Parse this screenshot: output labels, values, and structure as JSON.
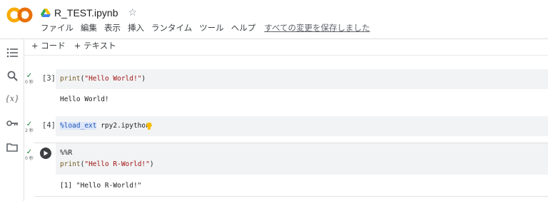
{
  "app": {
    "logo_text": "CO",
    "notebook_title": "R_TEST.ipynb",
    "star_glyph": "☆",
    "brand_colors": {
      "orange": "#f9ab00",
      "dark_orange": "#e8710a"
    }
  },
  "menu": {
    "items": [
      "ファイル",
      "編集",
      "表示",
      "挿入",
      "ランタイム",
      "ツール",
      "ヘルプ"
    ],
    "save_status": "すべての変更を保存しました"
  },
  "sidebar": {
    "icons": [
      "table-of-contents-icon",
      "search-icon",
      "variables-icon",
      "key-icon",
      "folder-icon"
    ],
    "variables_label": "{x}"
  },
  "toolbar": {
    "add_code": "+ コード",
    "add_text": "+ テキスト"
  },
  "cells": [
    {
      "check": "✓",
      "duration": "0 秒",
      "exec_count": "[3]",
      "code": {
        "fn": "print",
        "open": "(",
        "str": "\"Hello World!\"",
        "close": ")"
      },
      "output": "Hello World!"
    },
    {
      "check": "✓",
      "duration": "2 秒",
      "exec_count": "[4]",
      "code": {
        "magic": "%load_ext",
        "rest": " rpy2.ipython"
      }
    },
    {
      "check": "✓",
      "duration": "0 秒",
      "code": {
        "line1": "%%R",
        "fn": "print",
        "open": "(",
        "str": "\"Hello R-World!\"",
        "close": ")"
      },
      "output": "[1] \"Hello R-World!\""
    }
  ]
}
